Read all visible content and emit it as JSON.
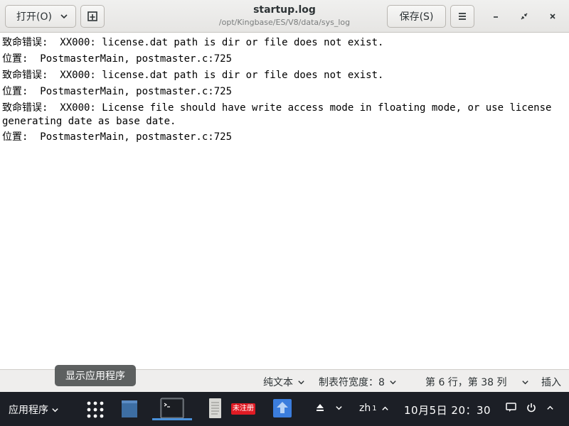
{
  "header": {
    "open_label": "打开(O)",
    "save_label": "保存(S)",
    "title": "startup.log",
    "subtitle": "/opt/Kingbase/ES/V8/data/sys_log"
  },
  "editor": {
    "lines": [
      "致命错误:  XX000: license.dat path is dir or file does not exist.",
      "位置:  PostmasterMain, postmaster.c:725",
      "致命错误:  XX000: license.dat path is dir or file does not exist.",
      "位置:  PostmasterMain, postmaster.c:725",
      "致命错误:  XX000: License file should have write access mode in floating mode, or use license generating date as base date.",
      "位置:  PostmasterMain, postmaster.c:725"
    ]
  },
  "statusbar": {
    "language": "纯文本",
    "tab_width": "制表符宽度：8",
    "position": "第 6 行，第 38 列",
    "insert_mode": "插入"
  },
  "tooltip": "显示应用程序",
  "taskbar": {
    "apps_menu": "应用程序",
    "unregistered_badge": "未注册",
    "input_method": "zh",
    "input_method_sub": "1",
    "clock": "10月5日  20：30"
  },
  "colors": {
    "taskbar_bg": "#1c1f26",
    "badge_red": "#e01b24",
    "active_underline": "#4a90d9"
  }
}
